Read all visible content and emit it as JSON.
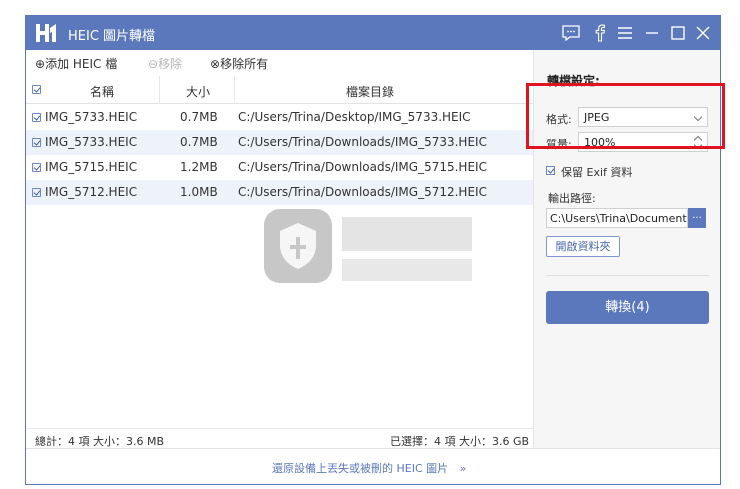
{
  "app": {
    "title": "HEIC 圖片轉檔"
  },
  "toolbar": {
    "add_label": "添加 HEIC 檔",
    "remove_label": "移除",
    "remove_all_label": "移除所有"
  },
  "table": {
    "headers": {
      "name": "名稱",
      "size": "大小",
      "path": "檔案目錄"
    },
    "rows": [
      {
        "name": "IMG_5733.HEIC",
        "size": "0.7MB",
        "path": "C:/Users/Trina/Desktop/IMG_5733.HEIC"
      },
      {
        "name": "IMG_5733.HEIC",
        "size": "0.7MB",
        "path": "C:/Users/Trina/Downloads/IMG_5733.HEIC"
      },
      {
        "name": "IMG_5715.HEIC",
        "size": "1.2MB",
        "path": "C:/Users/Trina/Downloads/IMG_5715.HEIC"
      },
      {
        "name": "IMG_5712.HEIC",
        "size": "1.0MB",
        "path": "C:/Users/Trina/Downloads/IMG_5712.HEIC"
      }
    ]
  },
  "stats": {
    "total": "總計：4 項 大小：3.6 MB",
    "selected": "已選擇：4 項 大小：3.6 GB"
  },
  "settings": {
    "title": "轉檔設定:",
    "format_label": "格式:",
    "format_value": "JPEG",
    "quality_label": "質量:",
    "quality_value": "100%",
    "exif_label": "保留 Exif 資料",
    "output_label": "輸出路徑:",
    "output_path": "C:\\Users\\Trina\\Documents\\",
    "browse_label": "...",
    "open_folder_label": "開啟資料夾",
    "convert_label": "轉換(4)"
  },
  "bottom": {
    "recover_link": "還原設備上丟失或被刪的 HEIC 圖片"
  },
  "colors": {
    "accent": "#5b78bd",
    "highlight": "#e0141e",
    "row_alt": "#eef2fa"
  }
}
